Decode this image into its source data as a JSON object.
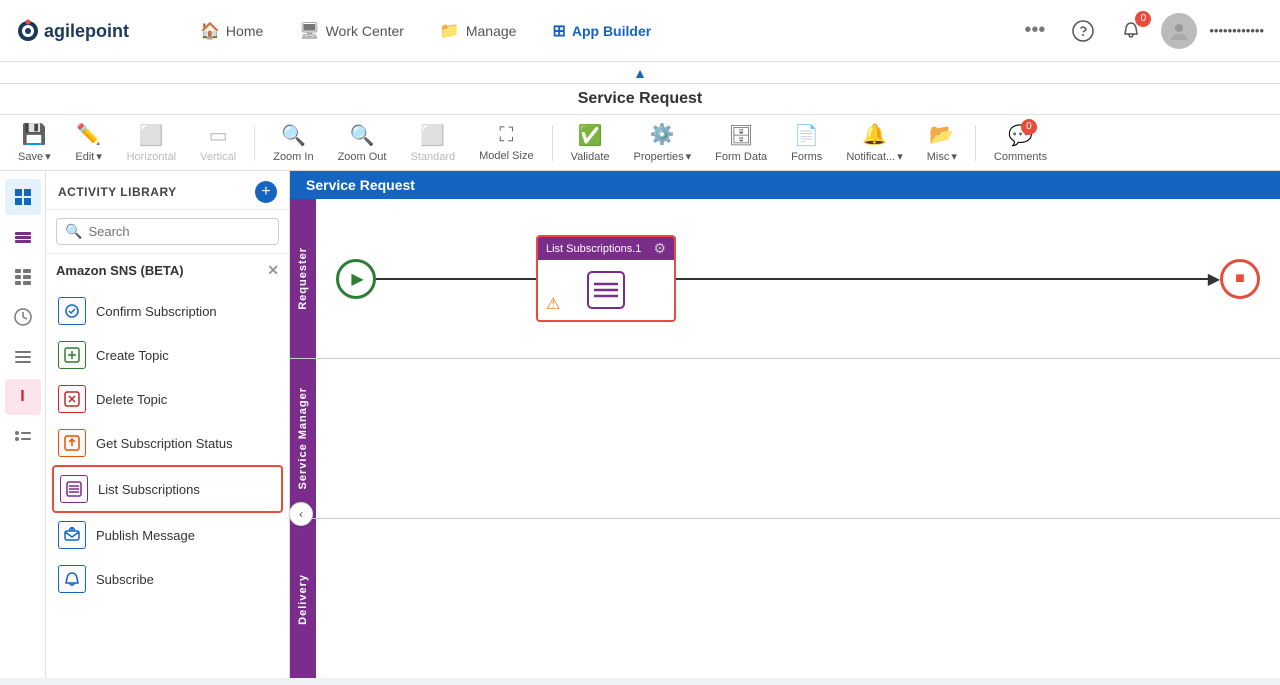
{
  "nav": {
    "logo": "agilepoint",
    "items": [
      {
        "id": "home",
        "label": "Home",
        "icon": "🏠"
      },
      {
        "id": "workcenter",
        "label": "Work Center",
        "icon": "🖥"
      },
      {
        "id": "manage",
        "label": "Manage",
        "icon": "📁"
      },
      {
        "id": "appbuilder",
        "label": "App Builder",
        "icon": "⊞",
        "active": true
      }
    ],
    "more_icon": "•••",
    "notification_count": "0",
    "user_display": "••••••••••••"
  },
  "page": {
    "title": "Service Request",
    "collapse_icon": "▲"
  },
  "toolbar": {
    "save_label": "Save",
    "edit_label": "Edit",
    "horizontal_label": "Horizontal",
    "vertical_label": "Vertical",
    "zoomin_label": "Zoom In",
    "zoomout_label": "Zoom Out",
    "standard_label": "Standard",
    "modelsize_label": "Model Size",
    "validate_label": "Validate",
    "properties_label": "Properties",
    "formdata_label": "Form Data",
    "forms_label": "Forms",
    "notifications_label": "Notificat...",
    "misc_label": "Misc",
    "comments_label": "Comments",
    "comments_count": "0"
  },
  "sidebar": {
    "add_title": "+",
    "activity_library_label": "ACTIVITY LIBRARY",
    "search_placeholder": "Search"
  },
  "library": {
    "section_label": "Amazon SNS (BETA)",
    "items": [
      {
        "id": "confirm-subscription",
        "label": "Confirm Subscription",
        "icon": "⟳",
        "color": "blue"
      },
      {
        "id": "create-topic",
        "label": "Create Topic",
        "icon": "+",
        "color": "green"
      },
      {
        "id": "delete-topic",
        "label": "Delete Topic",
        "icon": "✕",
        "color": "red"
      },
      {
        "id": "get-subscription-status",
        "label": "Get Subscription Status",
        "icon": "↑",
        "color": "orange"
      },
      {
        "id": "list-subscriptions",
        "label": "List Subscriptions",
        "icon": "≡",
        "color": "purple",
        "selected": true
      },
      {
        "id": "publish-message",
        "label": "Publish Message",
        "icon": "↑",
        "color": "blue"
      },
      {
        "id": "subscribe",
        "label": "Subscribe",
        "icon": "🔔",
        "color": "blue"
      }
    ]
  },
  "canvas": {
    "title": "Service Request",
    "lanes": [
      {
        "id": "requester",
        "label": "Requester"
      },
      {
        "id": "service-manager",
        "label": "Service Manager"
      },
      {
        "id": "delivery",
        "label": "Delivery"
      }
    ],
    "activity_node": {
      "title": "List Subscriptions.1",
      "has_warning": true,
      "warning_symbol": "⚠"
    }
  }
}
